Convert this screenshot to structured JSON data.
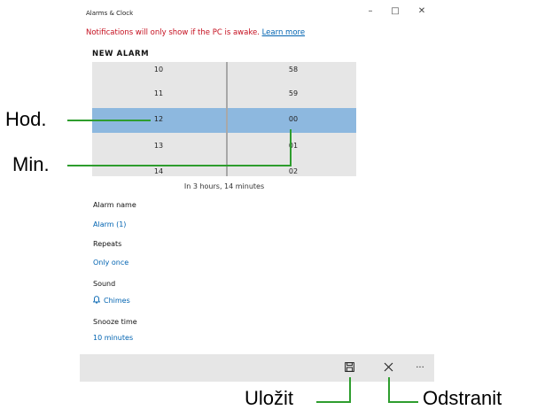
{
  "window": {
    "title": "Alarms & Clock",
    "minimize_label": "–",
    "maximize_label": "□",
    "close_label": "✕"
  },
  "notice": {
    "text": "Notifications will only show if the PC is awake.",
    "link": "Learn more"
  },
  "section_title": "NEW ALARM",
  "picker": {
    "hours": [
      "10",
      "11",
      "12",
      "13",
      "14"
    ],
    "minutes": [
      "58",
      "59",
      "00",
      "01",
      "02"
    ],
    "selected_hour": "12",
    "selected_minute": "00"
  },
  "countdown": "In 3 hours, 14 minutes",
  "fields": {
    "name_label": "Alarm name",
    "name_value": "Alarm (1)",
    "repeats_label": "Repeats",
    "repeats_value": "Only once",
    "sound_label": "Sound",
    "sound_value": "Chimes",
    "snooze_label": "Snooze time",
    "snooze_value": "10 minutes"
  },
  "commandbar": {
    "more_label": "···"
  },
  "annotations": {
    "hour": "Hod.",
    "minute": "Min.",
    "save": "Uložit",
    "delete": "Odstranit"
  },
  "colors": {
    "accent": "#0063b1",
    "selection": "#8db8df",
    "warning": "#c50f1f",
    "callout_line": "#2e9d2e",
    "picker_bg": "#e6e6e6"
  }
}
